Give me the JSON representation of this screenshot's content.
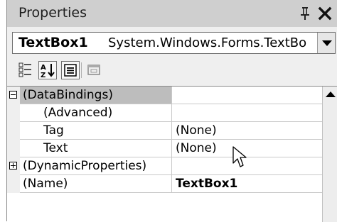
{
  "window": {
    "title": "Properties"
  },
  "object_selector": {
    "name": "TextBox1",
    "type": "System.Windows.Forms.TextBo"
  },
  "toolbar": {
    "buttons": [
      {
        "icon": "categorized-icon",
        "pressed": false
      },
      {
        "icon": "alphabetical-sort-icon",
        "pressed": true
      },
      {
        "icon": "properties-icon",
        "pressed": true
      },
      {
        "icon": "events-icon",
        "pressed": false
      }
    ]
  },
  "grid": {
    "rows": [
      {
        "name": "(DataBindings)",
        "value": "",
        "expander": "collapse"
      },
      {
        "name": "(Advanced)",
        "value": ""
      },
      {
        "name": "Tag",
        "value": "(None)"
      },
      {
        "name": "Text",
        "value": "(None)"
      },
      {
        "name": "(DynamicProperties)",
        "value": "",
        "expander": "expand"
      },
      {
        "name": "(Name)",
        "value": "TextBox1"
      }
    ]
  }
}
